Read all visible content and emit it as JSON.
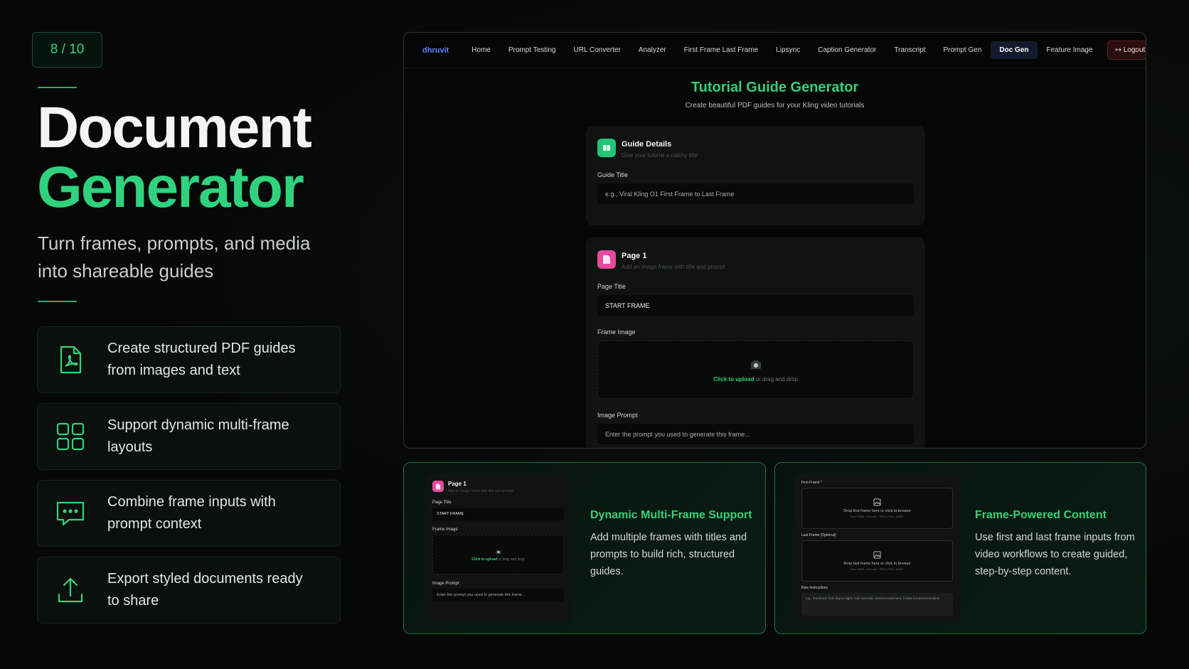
{
  "slide": {
    "counter": "8 / 10"
  },
  "hero": {
    "title_line1": "Document",
    "title_line2": "Generator",
    "subtitle": "Turn frames, prompts, and media into shareable guides"
  },
  "features": [
    {
      "icon": "pdf-file-icon",
      "text": "Create structured PDF guides from images and text"
    },
    {
      "icon": "grid-icon",
      "text": "Support dynamic multi-frame layouts"
    },
    {
      "icon": "chat-bubble-icon",
      "text": "Combine frame inputs with prompt context"
    },
    {
      "icon": "upload-icon",
      "text": "Export styled documents ready to share"
    }
  ],
  "app": {
    "brand": "dhruvit",
    "nav": [
      "Home",
      "Prompt Testing",
      "URL Converter",
      "Analyzer",
      "First Frame Last Frame",
      "Lipsync",
      "Caption Generator",
      "Transcript",
      "Prompt Gen",
      "Doc Gen",
      "Feature Image"
    ],
    "active_nav": "Doc Gen",
    "logout": "Logout",
    "title": "Tutorial Guide Generator",
    "subtitle": "Create beautiful PDF guides for your Kling video tutorials",
    "guide_card": {
      "title": "Guide Details",
      "hint": "Give your tutorial a catchy title",
      "field_label": "Guide Title",
      "placeholder": "e.g., Viral Kling O1 First Frame to Last Frame"
    },
    "page_card": {
      "title": "Page 1",
      "hint": "Add an image frame with title and prompt",
      "page_title_label": "Page Title",
      "page_title_value": "START FRAME",
      "frame_image_label": "Frame Image",
      "upload_link": "Click to upload",
      "upload_rest": " or drag and drop",
      "image_prompt_label": "Image Prompt",
      "image_prompt_placeholder": "Enter the prompt you used to generate this frame..."
    }
  },
  "promo1": {
    "title": "Dynamic Multi-Frame Support",
    "description": "Add multiple frames with titles and prompts to build rich, structured guides."
  },
  "promo2": {
    "title": "Frame-Powered Content",
    "description": "Use first and last frame inputs from video workflows to create guided, step-by-step content.",
    "first_frame_label": "First Frame *",
    "first_drop": "Drop first frame here or click to browse",
    "first_meta": "Max 10MB • Formats: JPEG, PNG, WEBP",
    "last_frame_label": "Last Frame (Optional)",
    "last_drop": "Drop last frame here or click to browse",
    "last_meta": "Max 10MB • Formats: JPEG, PNG, WEBP",
    "raw_label": "Raw Instructions",
    "raw_placeholder": "e.g., Transform from day to night, Add cinematic camera movement, Create a surreal transition"
  },
  "colors": {
    "accent": "#33d17a",
    "brand": "#5b86ff",
    "pink": "#e64a9d"
  }
}
